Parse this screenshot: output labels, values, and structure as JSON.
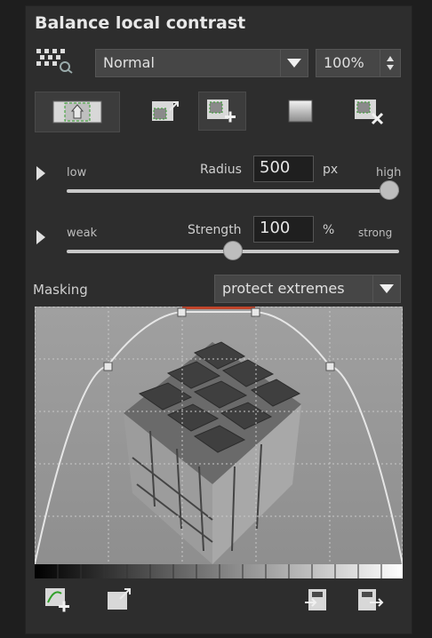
{
  "panel": {
    "title": "Balance local contrast"
  },
  "blend": {
    "mode": "Normal",
    "opacity": "100%"
  },
  "radius": {
    "left": "low",
    "label": "Radius",
    "value": "500",
    "unit": "px",
    "right": "high",
    "level": 1.0
  },
  "strength": {
    "left": "weak",
    "label": "Strength",
    "value": "100",
    "unit": "%",
    "right": "strong",
    "level": 0.5
  },
  "masking": {
    "label": "Masking",
    "mode": "protect extremes"
  },
  "icons": [
    "mask-preview-icon",
    "mask-picker-icon",
    "full-image-icon",
    "load-preset-icon",
    "add-mask-icon",
    "gradient-mask-icon",
    "delete-mask-icon",
    "add-point-icon",
    "load-curve-icon",
    "import-curve-icon",
    "save-curve-icon"
  ],
  "colors": {
    "accent_curve": "#cfcfcf",
    "red_marker": "#c0442a",
    "mask_green": "#31a02a"
  }
}
